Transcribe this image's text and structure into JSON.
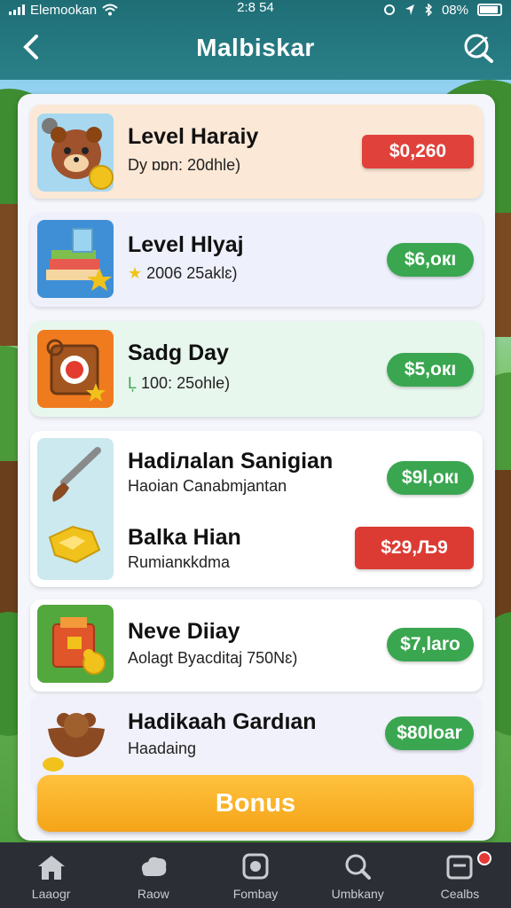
{
  "status_bar": {
    "carrier": "Elemookan",
    "time": "2:8 54",
    "battery": "08%"
  },
  "header": {
    "title": "Malbiskar"
  },
  "items": [
    {
      "title": "Level Haraiy",
      "subtitle": "Dy ɒɒn: 20dhle)",
      "price": "$0,260",
      "price_color": "#e0413b",
      "background": "#fbe8d6",
      "icon": "bear-face-icon"
    },
    {
      "title": "Level Hlyaj",
      "subtitle": "2006 25aklɛ)",
      "price": "$6,oкı",
      "price_color": "#3aa650",
      "background": "#eef0fb",
      "icon": "books-icon"
    },
    {
      "title": "Sadg Day",
      "subtitle": "100: 25ohle)",
      "price": "$5,oкı",
      "price_color": "#3aa650",
      "background": "#e8f7ee",
      "icon": "target-box-icon"
    },
    {
      "title": "Hadiлalan Sanigian",
      "subtitle": "Haoian Canabmjantan",
      "price": "$9l,oкı",
      "price_color": "#3aa650",
      "background": "#ffffff",
      "icon": "paintbrush-icon"
    },
    {
      "title": "Balka Hian",
      "subtitle": "Rumianĸkdma",
      "price": "$29,Љ9",
      "price_color": "#dc3b33",
      "background": "#ffffff",
      "icon": "gold-bars-icon"
    },
    {
      "title": "Neve Diiay",
      "subtitle": "Aolagt Byacditaj 750Nɛ)",
      "price": "$7,laro",
      "price_color": "#3aa650",
      "background": "#ffffff",
      "icon": "treasure-bag-icon"
    },
    {
      "title": "Hadikaah Gardıan",
      "subtitle": "Haadaing",
      "price": "$80loar",
      "price_color": "#3aa650",
      "background": "#f1f1fb",
      "icon": "cookie-bowl-icon"
    }
  ],
  "bonus_button": {
    "label": "Bonus"
  },
  "tabs": [
    {
      "label": "Laaogr",
      "icon": "home-icon"
    },
    {
      "label": "Raow",
      "icon": "cloud-hand-icon"
    },
    {
      "label": "Fombay",
      "icon": "record-icon"
    },
    {
      "label": "Umbkany",
      "icon": "search-icon"
    },
    {
      "label": "Cealbs",
      "icon": "cart-icon"
    }
  ]
}
